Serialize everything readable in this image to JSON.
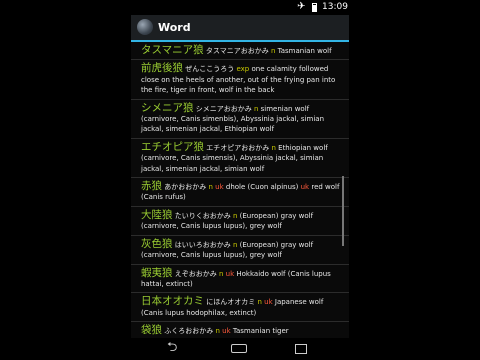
{
  "status": {
    "time": "13:09",
    "airplane_icon": "airplane-icon",
    "battery_icon": "battery-icon"
  },
  "actionbar": {
    "title": "Word",
    "app_icon": "globe-icon"
  },
  "entries": [
    {
      "kanji": "タスマニア狼",
      "kana": "タスマニアおおかみ",
      "pos": "n",
      "uk": "",
      "gloss": "Tasmanian wolf"
    },
    {
      "kanji": "前虎後狼",
      "kana": "ぜんここうろう",
      "pos": "exp",
      "uk": "",
      "gloss": "one calamity followed close on the heels of another, out of the frying pan into the fire, tiger in front, wolf in the back"
    },
    {
      "kanji": "シメニア狼",
      "kana": "シメニアおおかみ",
      "pos": "n",
      "uk": "",
      "gloss": "simenian wolf (carnivore, Canis simenbis), Abyssinia jackal, simian jackal, simenian jackal, Ethiopian wolf"
    },
    {
      "kanji": "エチオピア狼",
      "kana": "エチオピアおおかみ",
      "pos": "n",
      "uk": "",
      "gloss": "Ethiopian wolf (carnivore, Canis simensis), Abyssinia jackal, simian jackal, simenian jackal, simian wolf"
    },
    {
      "kanji": "赤狼",
      "kana": "あかおおかみ",
      "pos": "n",
      "uk": "uk",
      "gloss": "dhole (Cuon alpinus) uk red wolf (Canis rufus)"
    },
    {
      "kanji": "大陸狼",
      "kana": "たいりくおおかみ",
      "pos": "n",
      "uk": "",
      "gloss": "(European) gray wolf (carnivore, Canis lupus lupus), grey wolf"
    },
    {
      "kanji": "灰色狼",
      "kana": "はいいろおおかみ",
      "pos": "n",
      "uk": "",
      "gloss": "(European) gray wolf (carnivore, Canis lupus lupus), grey wolf"
    },
    {
      "kanji": "蝦夷狼",
      "kana": "えぞおおかみ",
      "pos": "n",
      "uk": "uk",
      "gloss": "Hokkaido wolf (Canis lupus hattai, extinct)"
    },
    {
      "kanji": "日本オオカミ",
      "kana": "にほんオオカミ",
      "pos": "n",
      "uk": "uk",
      "gloss": "Japanese wolf (Canis lupus hodophilax, extinct)"
    },
    {
      "kanji": "袋狼",
      "kana": "ふくろおおかみ",
      "pos": "n",
      "uk": "uk",
      "gloss": "Tasmanian tiger"
    }
  ],
  "nav": {
    "back": "back-icon",
    "home": "home-icon",
    "recent": "recent-apps-icon"
  }
}
